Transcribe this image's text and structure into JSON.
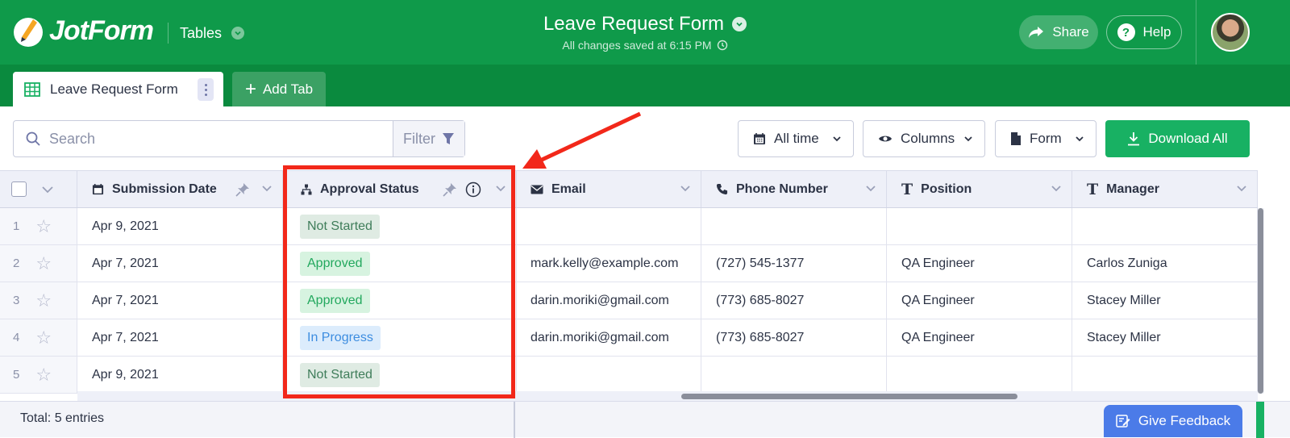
{
  "header": {
    "logo_text": "JotForm",
    "tables_label": "Tables",
    "form_title": "Leave Request Form",
    "saved_status": "All changes saved at 6:15 PM",
    "share_label": "Share",
    "help_label": "Help"
  },
  "tabs": {
    "active_label": "Leave Request Form",
    "add_label": "Add Tab"
  },
  "toolbar": {
    "search_placeholder": "Search",
    "filter_label": "Filter",
    "time_label": "All time",
    "columns_label": "Columns",
    "form_label": "Form",
    "download_label": "Download All"
  },
  "columns": {
    "submission_date": "Submission Date",
    "approval_status": "Approval Status",
    "email": "Email",
    "phone": "Phone Number",
    "position": "Position",
    "manager": "Manager"
  },
  "rows": [
    {
      "num": "1",
      "date": "Apr 9, 2021",
      "status": "Not Started",
      "email": "",
      "phone": "",
      "position": "",
      "manager": ""
    },
    {
      "num": "2",
      "date": "Apr 7, 2021",
      "status": "Approved",
      "email": "mark.kelly@example.com",
      "phone": "(727) 545-1377",
      "position": "QA Engineer",
      "manager": "Carlos Zuniga"
    },
    {
      "num": "3",
      "date": "Apr 7, 2021",
      "status": "Approved",
      "email": "darin.moriki@gmail.com",
      "phone": "(773) 685-8027",
      "position": "QA Engineer",
      "manager": "Stacey Miller"
    },
    {
      "num": "4",
      "date": "Apr 7, 2021",
      "status": "In Progress",
      "email": "darin.moriki@gmail.com",
      "phone": "(773) 685-8027",
      "position": "QA Engineer",
      "manager": "Stacey Miller"
    },
    {
      "num": "5",
      "date": "Apr 9, 2021",
      "status": "Not Started",
      "email": "",
      "phone": "",
      "position": "",
      "manager": ""
    }
  ],
  "footer": {
    "total": "Total: 5 entries",
    "feedback_label": "Give Feedback"
  },
  "colors": {
    "brand_green": "#0f9a4a",
    "download_green": "#18b163",
    "highlight_red": "#f2281a",
    "feedback_blue": "#4b7be8"
  }
}
